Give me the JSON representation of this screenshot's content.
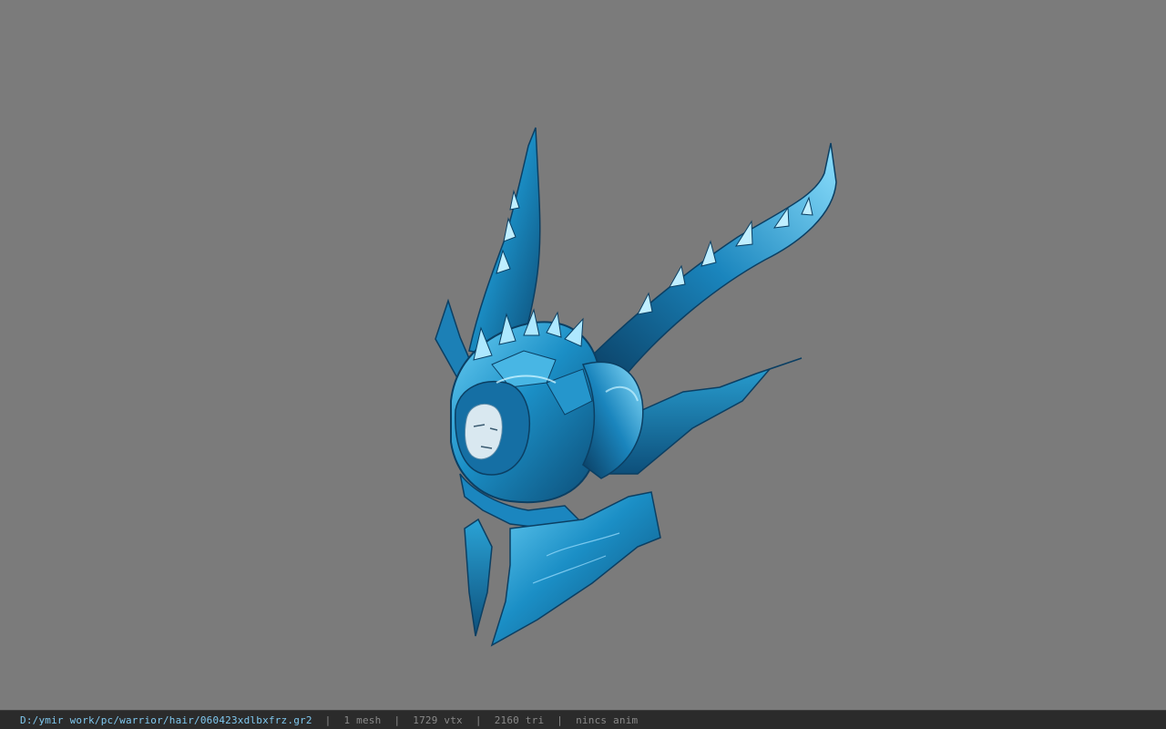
{
  "viewport": {
    "background_color": "#7b7b7b",
    "model_name": "ice-dragon-helmet"
  },
  "statusbar": {
    "file_path": "D:/ymir work/pc/warrior/hair/060423xdlbxfrz.gr2",
    "separator": "|",
    "mesh_count": "1 mesh",
    "vertex_count": "1729 vtx",
    "triangle_count": "2160 tri",
    "anim_status": "nincs anim",
    "path_color": "#7fc7ee",
    "text_color": "#8a8a8a",
    "background_color": "#2b2b2b"
  },
  "model": {
    "primary_color": "#1e8fc4",
    "highlight_color": "#9fe0ff",
    "shadow_color": "#0b3f63"
  }
}
